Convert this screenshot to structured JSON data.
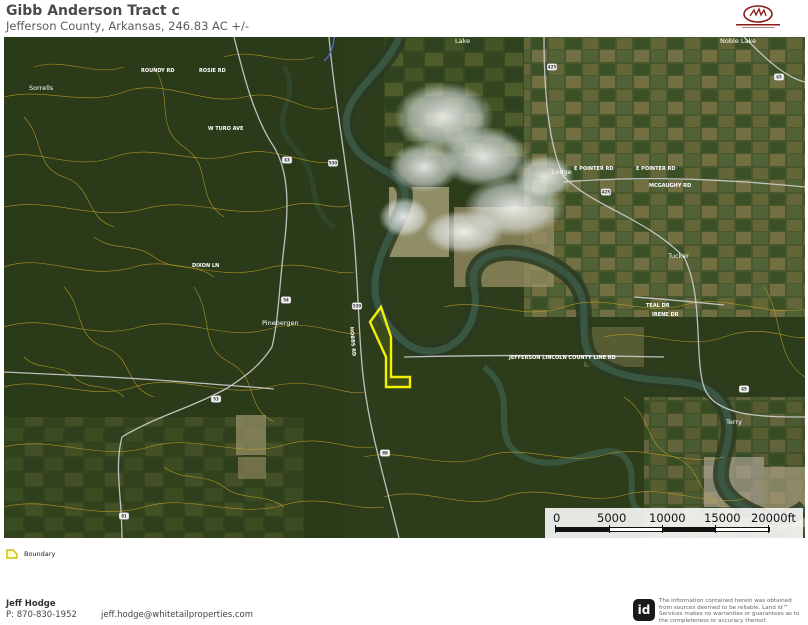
{
  "header": {
    "title": "Gibb Anderson Tract c",
    "subtitle": "Jefferson County, Arkansas, 246.83 AC +/-"
  },
  "logo": {
    "icon": "whitetail-properties-logo",
    "accent": "#8b1a1a"
  },
  "map": {
    "type": "satellite-with-contours",
    "contour_color": "#c9a227",
    "boundary_color": "#f2f200",
    "road_color": "#cfcfcf",
    "place_labels": [
      "Sorrells",
      "Pinebergen",
      "Noble Lake",
      "Lodge",
      "Tucker",
      "Terry",
      "Lake"
    ],
    "road_labels": [
      "E POINTER RD",
      "E POINTER RD",
      "MCGAUGHY RD",
      "TEAL DR",
      "IRENE DR",
      "JEFFERSON LINCOLN COUNTY LINE RD",
      "DIXON LN",
      "W TURO AVE",
      "ROUNDY RD",
      "ROSIE RD",
      "HOBBS RD"
    ],
    "route_shields": [
      "530",
      "65",
      "425",
      "530",
      "63",
      "54",
      "53",
      "81",
      "88",
      "425",
      "65"
    ]
  },
  "scale": {
    "labels": [
      "0",
      "5000",
      "10000",
      "15000",
      "20000ft"
    ]
  },
  "legend": {
    "items": [
      {
        "label": "Boundary",
        "color": "#f2f200",
        "icon": "boundary-swatch"
      }
    ]
  },
  "footer": {
    "agent_name": "Jeff Hodge",
    "agent_phone": "P: 870-830-1952",
    "agent_email": "jeff.hodge@whitetailproperties.com",
    "id_logo_text": "id",
    "disclaimer": "The information contained herein was obtained from sources deemed to be reliable. Land id™ Services makes no warranties or guarantees as to the completeness or accuracy thereof."
  }
}
